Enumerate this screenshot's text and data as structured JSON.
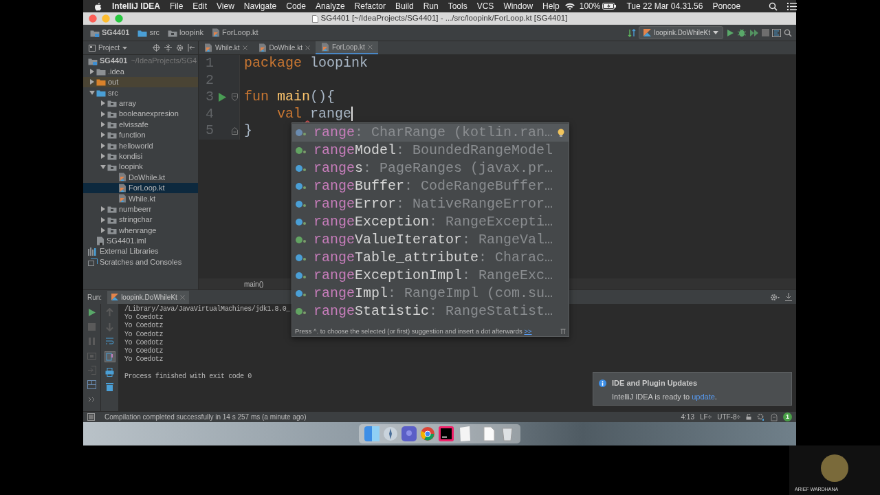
{
  "menu_bar": {
    "app": "IntelliJ IDEA",
    "menus": [
      "File",
      "Edit",
      "View",
      "Navigate",
      "Code",
      "Analyze",
      "Refactor",
      "Build",
      "Run",
      "Tools",
      "VCS",
      "Window",
      "Help"
    ],
    "battery": "100%",
    "clock": "Tue 22 Mar 04.31.56",
    "user": "Poncoe"
  },
  "window": {
    "title": "SG4401 [~/IdeaProjects/SG4401] - .../src/loopink/ForLoop.kt [SG4401]"
  },
  "breadcrumbs": [
    {
      "text": "SG4401",
      "kind": "project"
    },
    {
      "text": "src",
      "kind": "source-folder"
    },
    {
      "text": "loopink",
      "kind": "package"
    },
    {
      "text": "ForLoop.kt",
      "kind": "kotlin-file"
    }
  ],
  "run_configuration": {
    "label": "loopink.DoWhileKt"
  },
  "project_panel": {
    "title": "Project",
    "tree": [
      {
        "label": "SG4401",
        "hint": "~/IdeaProjects/SG4",
        "kind": "project",
        "selected": false,
        "children": [
          {
            "label": ".idea",
            "kind": "folder",
            "expanded": false,
            "selected": false
          },
          {
            "label": "out",
            "kind": "excluded-folder",
            "expanded": false,
            "selected": false
          },
          {
            "label": "src",
            "kind": "source-folder",
            "expanded": true,
            "selected": false,
            "children": [
              {
                "label": "array",
                "kind": "package",
                "expanded": false,
                "selected": false
              },
              {
                "label": "booleanexpresion",
                "kind": "package",
                "expanded": false,
                "selected": false
              },
              {
                "label": "elvissafe",
                "kind": "package",
                "expanded": false,
                "selected": false
              },
              {
                "label": "function",
                "kind": "package",
                "expanded": false,
                "selected": false
              },
              {
                "label": "helloworld",
                "kind": "package",
                "expanded": false,
                "selected": false
              },
              {
                "label": "kondisi",
                "kind": "package",
                "expanded": false,
                "selected": false
              },
              {
                "label": "loopink",
                "kind": "package",
                "expanded": true,
                "selected": false,
                "children": [
                  {
                    "label": "DoWhile.kt",
                    "kind": "kotlin-file",
                    "selected": false
                  },
                  {
                    "label": "ForLoop.kt",
                    "kind": "kotlin-file",
                    "selected": true
                  },
                  {
                    "label": "While.kt",
                    "kind": "kotlin-file",
                    "selected": false
                  }
                ]
              },
              {
                "label": "numbeerr",
                "kind": "package",
                "expanded": false,
                "selected": false
              },
              {
                "label": "stringchar",
                "kind": "package",
                "expanded": false,
                "selected": false
              },
              {
                "label": "whenrange",
                "kind": "package",
                "expanded": false,
                "selected": false
              }
            ]
          },
          {
            "label": "SG4401.iml",
            "kind": "module-file",
            "selected": false
          }
        ]
      },
      {
        "label": "External Libraries",
        "kind": "libraries",
        "selected": false
      },
      {
        "label": "Scratches and Consoles",
        "kind": "scratches",
        "selected": false
      }
    ]
  },
  "editor_tabs": [
    {
      "label": "While.kt",
      "selected": false
    },
    {
      "label": "DoWhile.kt",
      "selected": false
    },
    {
      "label": "ForLoop.kt",
      "selected": true
    }
  ],
  "editor": {
    "lines": [
      {
        "number": "1",
        "run_marker": false,
        "caret": false,
        "tokens": [
          {
            "kind": "keyword",
            "text": "package"
          },
          {
            "kind": "plain",
            "text": " loopink"
          }
        ]
      },
      {
        "number": "2",
        "run_marker": false,
        "caret": false
      },
      {
        "number": "3",
        "run_marker": true,
        "caret": false,
        "fold": {
          "kind": "open"
        },
        "tokens": [
          {
            "kind": "keyword",
            "text": "fun"
          },
          {
            "kind": "function",
            "text": " main"
          },
          {
            "kind": "plain",
            "text": "(){"
          }
        ]
      },
      {
        "number": "4",
        "run_marker": false,
        "caret": true,
        "tokens": [
          {
            "kind": "keyword",
            "text": "    val",
            "error": false
          },
          {
            "kind": "plain",
            "text": " range",
            "error": true
          }
        ]
      },
      {
        "number": "5",
        "run_marker": false,
        "caret": false,
        "fold": {
          "kind": "close"
        },
        "tokens": [
          {
            "kind": "plain",
            "text": "}"
          }
        ]
      }
    ],
    "breadcrumb": "main()"
  },
  "completion": {
    "items": [
      {
        "kind": "property",
        "match": "range",
        "type": ": CharRange (kotlin.ran…",
        "selected": true
      },
      {
        "kind": "interface",
        "match": "range",
        "rest": "Model",
        "type": ": BoundedRangeModel",
        "selected": false
      },
      {
        "kind": "class",
        "match": "range",
        "rest": "s",
        "type": ": PageRanges (javax.pr…",
        "selected": false
      },
      {
        "kind": "class",
        "match": "range",
        "rest": "Buffer",
        "type": ": CodeRangeBuffer…",
        "selected": false
      },
      {
        "kind": "class",
        "match": "range",
        "rest": "Error",
        "type": ": NativeRangeError…",
        "selected": false
      },
      {
        "kind": "class",
        "match": "range",
        "rest": "Exception",
        "type": ": RangeExcepti…",
        "selected": false
      },
      {
        "kind": "interface",
        "match": "range",
        "rest": "ValueIterator",
        "type": ": RangeVal…",
        "selected": false
      },
      {
        "kind": "class",
        "match": "range",
        "rest": "Table_attribute",
        "type": ": Charac…",
        "selected": false
      },
      {
        "kind": "class",
        "match": "range",
        "rest": "ExceptionImpl",
        "type": ": RangeExc…",
        "selected": false
      },
      {
        "kind": "class",
        "match": "range",
        "rest": "Impl",
        "type": ": RangeImpl (com.su…",
        "selected": false
      },
      {
        "kind": "interface",
        "match": "range",
        "rest": "Statistic",
        "type": ": RangeStatist…",
        "selected": false
      }
    ],
    "hint": "Press ^. to choose the selected (or first) suggestion and insert a dot afterwards",
    "hint_link": ">>"
  },
  "run_panel": {
    "label": "Run:",
    "tab": "loopink.DoWhileKt",
    "output": [
      "/Library/Java/JavaVirtualMachines/jdk1.8.0_",
      "Yo Coedotz",
      "Yo Coedotz",
      "Yo Coedotz",
      "Yo Coedotz",
      "Yo Coedotz",
      "Yo Coedotz"
    ],
    "exit_message": "Process finished with exit code 0"
  },
  "status_bar": {
    "message": "Compilation completed successfully in 14 s 257 ms (a minute ago)",
    "position": "4:13",
    "line_separator": "LF÷",
    "encoding": "UTF-8÷",
    "event_count": "1"
  },
  "notification": {
    "title": "IDE and Plugin Updates",
    "body": "IntelliJ IDEA is ready to ",
    "link": "update",
    "tail": "."
  },
  "participant": {
    "name": "ARIEF WARDHANA"
  }
}
